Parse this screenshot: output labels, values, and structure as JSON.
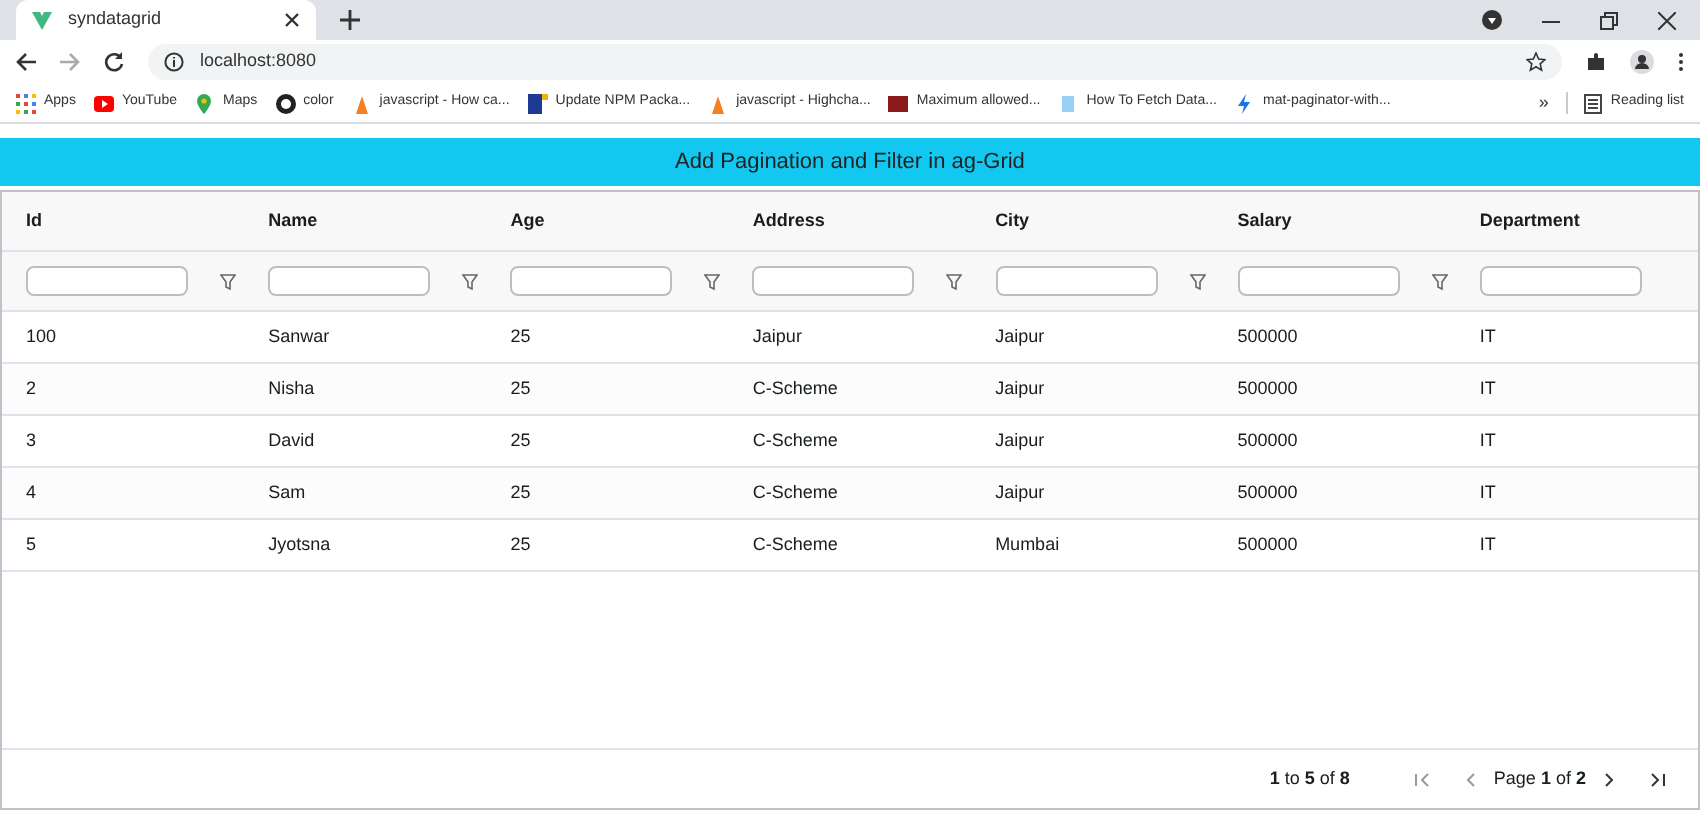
{
  "browser": {
    "tab_title": "syndatagrid",
    "url": "localhost:8080",
    "bookmarks": [
      "Apps",
      "YouTube",
      "Maps",
      "color",
      "javascript - How ca...",
      "Update NPM Packa...",
      "javascript - Highcha...",
      "Maximum allowed...",
      "How To Fetch Data...",
      "mat-paginator-with..."
    ],
    "overflow": "»",
    "reading_list": "Reading list"
  },
  "banner": "Add Pagination and Filter in ag-Grid",
  "grid": {
    "columns": [
      {
        "label": "Id",
        "filter_icon": true
      },
      {
        "label": "Name",
        "filter_icon": true
      },
      {
        "label": "Age",
        "filter_icon": true
      },
      {
        "label": "Address",
        "filter_icon": true
      },
      {
        "label": "City",
        "filter_icon": true
      },
      {
        "label": "Salary",
        "filter_icon": true
      },
      {
        "label": "Department",
        "filter_icon": false
      }
    ],
    "rows": [
      [
        "100",
        "Sanwar",
        "25",
        "Jaipur",
        "Jaipur",
        "500000",
        "IT"
      ],
      [
        "2",
        "Nisha",
        "25",
        "C-Scheme",
        "Jaipur",
        "500000",
        "IT"
      ],
      [
        "3",
        "David",
        "25",
        "C-Scheme",
        "Jaipur",
        "500000",
        "IT"
      ],
      [
        "4",
        "Sam",
        "25",
        "C-Scheme",
        "Jaipur",
        "500000",
        "IT"
      ],
      [
        "5",
        "Jyotsna",
        "25",
        "C-Scheme",
        "Mumbai",
        "500000",
        "IT"
      ]
    ],
    "summary": "**1** to **5** of **8**",
    "page": "Page **1** of **2**"
  }
}
